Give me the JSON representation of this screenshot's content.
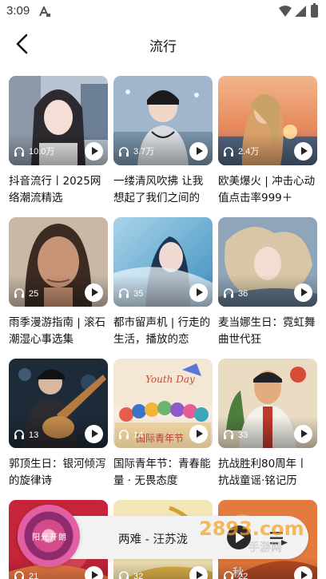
{
  "status_bar": {
    "time": "3:09"
  },
  "header": {
    "title": "流行"
  },
  "playlists": [
    {
      "count": "10.0万",
      "title": "抖音流行丨2025网络潮流精选"
    },
    {
      "count": "3.7万",
      "title": "一缕清风吹拂 让我想起了我们之间的"
    },
    {
      "count": "2.4万",
      "title": "欧美爆火 | 冲击心动值点击率999＋"
    },
    {
      "count": "25",
      "title": "雨季漫游指南 | 滚石潮湿心事选集"
    },
    {
      "count": "35",
      "title": "都市留声机 | 行走的生活，播放的恋"
    },
    {
      "count": "36",
      "title": "麦当娜生日：霓虹舞曲世代狂"
    },
    {
      "count": "13",
      "title": "郭顶生日：银河倾泻的旋律诗"
    },
    {
      "count": "14",
      "title": "国际青年节：青春能量 · 无畏态度"
    },
    {
      "count": "33",
      "title": "抗战胜利80周年丨抗战童谣·铭记历"
    },
    {
      "count": "21",
      "title": ""
    },
    {
      "count": "32",
      "title": ""
    },
    {
      "count": "22",
      "title": ""
    }
  ],
  "thumb_texts": {
    "youth_day_top": "Youth Day",
    "youth_day_bottom": "国际青年节",
    "sticker": "秋"
  },
  "player": {
    "song": "两难 - 汪苏泷",
    "disc_label": "阳光开朗"
  },
  "watermark": {
    "text": "2893.com",
    "sub": "手游网"
  }
}
